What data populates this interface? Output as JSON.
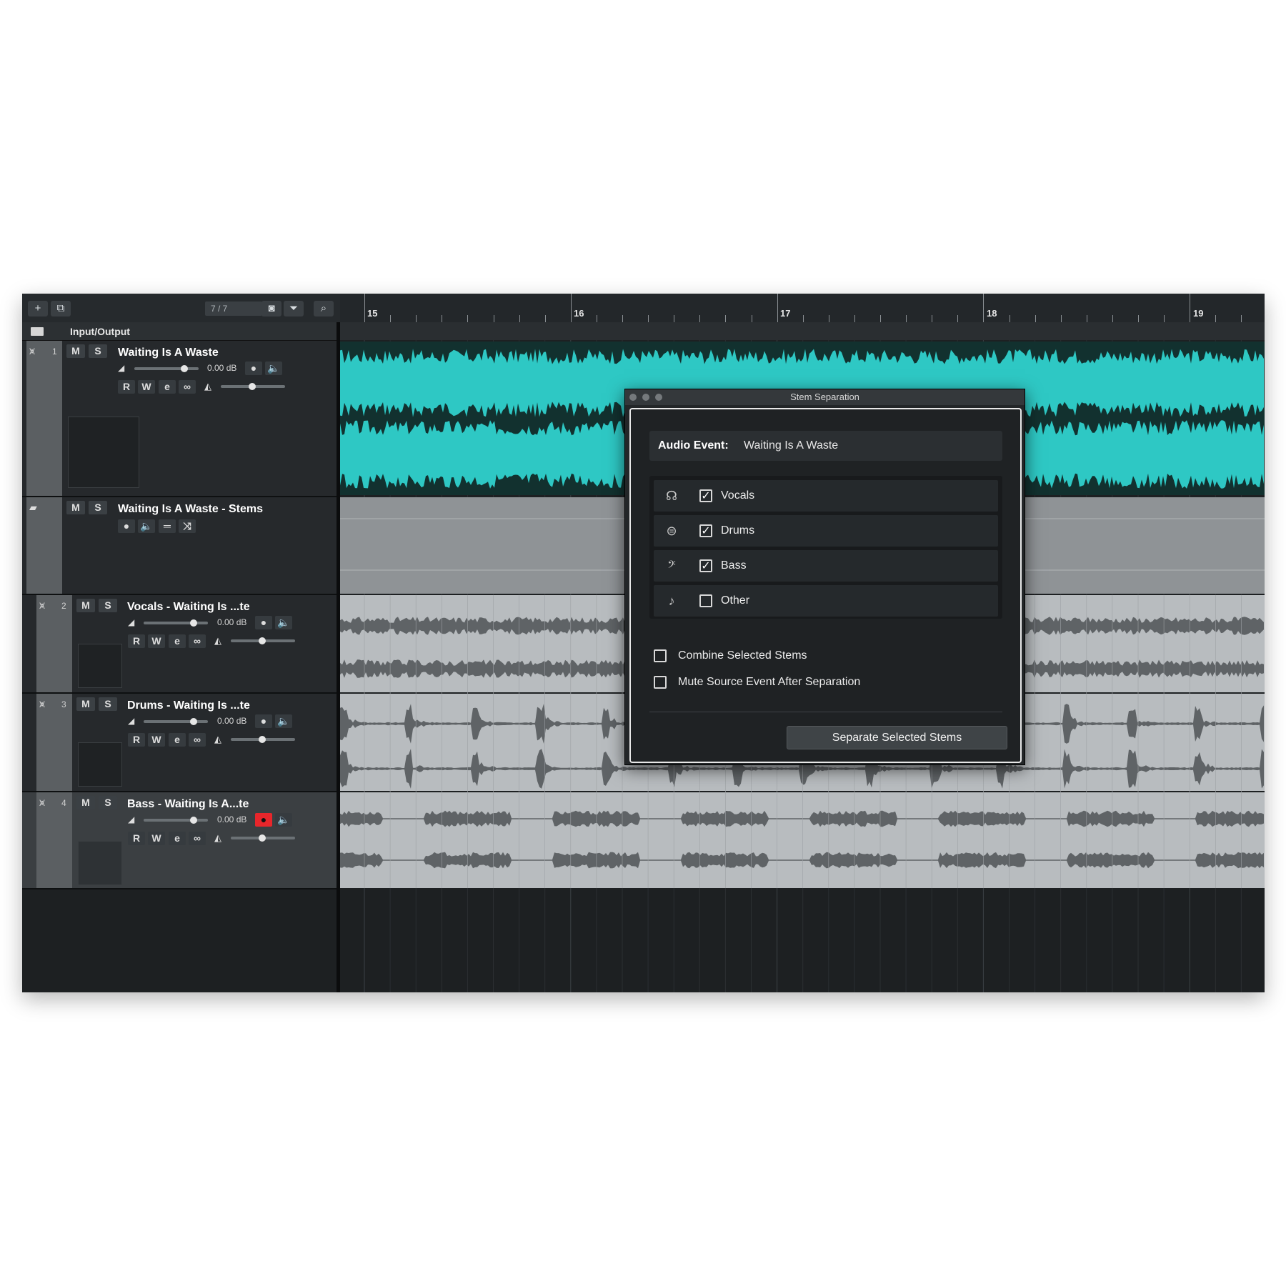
{
  "toolbar": {
    "add_icon": "+",
    "dup_icon": "⧉",
    "track_count": "7 / 7",
    "icons": [
      "camera-icon",
      "filter-icon",
      "search-icon"
    ]
  },
  "ruler": {
    "bars": [
      "15",
      "16",
      "17",
      "18",
      "19"
    ]
  },
  "io": {
    "label": "Input/Output"
  },
  "tracks": [
    {
      "number": "1",
      "name": "Waiting Is A Waste",
      "mute": "M",
      "solo": "S",
      "volume": "0.00 dB",
      "read": "R",
      "write": "W"
    },
    {
      "number": "",
      "name": "Waiting Is A Waste - Stems",
      "mute": "M",
      "solo": "S"
    },
    {
      "number": "2",
      "name": "Vocals - Waiting Is ...te",
      "mute": "M",
      "solo": "S",
      "volume": "0.00 dB",
      "read": "R",
      "write": "W"
    },
    {
      "number": "3",
      "name": "Drums - Waiting Is ...te",
      "mute": "M",
      "solo": "S",
      "volume": "0.00 dB",
      "read": "R",
      "write": "W"
    },
    {
      "number": "4",
      "name": "Bass - Waiting Is A...te",
      "mute": "M",
      "solo": "S",
      "volume": "0.00 dB",
      "read": "R",
      "write": "W",
      "record_armed": true
    }
  ],
  "dialog": {
    "title": "Stem Separation",
    "audio_event_label": "Audio Event:",
    "audio_event_value": "Waiting Is A Waste",
    "stems": [
      {
        "label": "Vocals",
        "checked": true,
        "icon": "vocals-icon"
      },
      {
        "label": "Drums",
        "checked": true,
        "icon": "drums-icon"
      },
      {
        "label": "Bass",
        "checked": true,
        "icon": "bass-clef-icon"
      },
      {
        "label": "Other",
        "checked": false,
        "icon": "other-instrument-icon"
      }
    ],
    "options": [
      {
        "label": "Combine Selected Stems",
        "checked": false
      },
      {
        "label": "Mute Source Event After Separation",
        "checked": false
      }
    ],
    "button": "Separate Selected Stems"
  },
  "colors": {
    "cyan_wave": "#2ec8c4",
    "stem_bg": "#b8bcbf",
    "record": "#e8262b"
  }
}
